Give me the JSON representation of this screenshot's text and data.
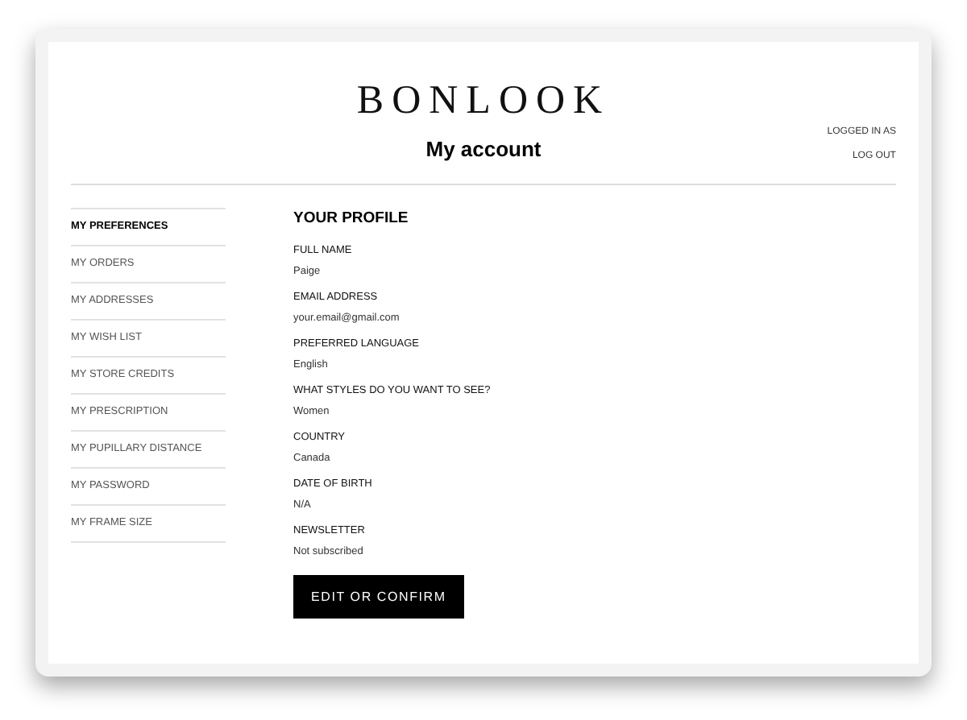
{
  "logo": "BONLOOK",
  "page_title": "My account",
  "account_links": [
    "LOGGED IN AS",
    "LOG OUT"
  ],
  "sidebar": {
    "items": [
      {
        "label": "MY PREFERENCES",
        "selected": true
      },
      {
        "label": "MY ORDERS",
        "selected": false
      },
      {
        "label": "MY ADDRESSES",
        "selected": false
      },
      {
        "label": "MY WISH LIST",
        "selected": false
      },
      {
        "label": "MY STORE CREDITS",
        "selected": false
      },
      {
        "label": "MY PRESCRIPTION",
        "selected": false
      },
      {
        "label": "MY PUPILLARY DISTANCE",
        "selected": false
      },
      {
        "label": "MY PASSWORD",
        "selected": false
      },
      {
        "label": "MY FRAME SIZE",
        "selected": false
      }
    ]
  },
  "profile": {
    "heading": "YOUR PROFILE",
    "fields": [
      {
        "label": "FULL NAME",
        "value": "Paige"
      },
      {
        "label": "EMAIL ADDRESS",
        "value": "your.email@gmail.com"
      },
      {
        "label": "PREFERRED LANGUAGE",
        "value": "English"
      },
      {
        "label": "WHAT STYLES DO YOU WANT TO SEE?",
        "value": "Women"
      },
      {
        "label": "COUNTRY",
        "value": "Canada"
      },
      {
        "label": "DATE OF BIRTH",
        "value": "N/A"
      },
      {
        "label": "NEWSLETTER",
        "value": "Not subscribed"
      }
    ],
    "button": "EDIT OR CONFIRM"
  }
}
